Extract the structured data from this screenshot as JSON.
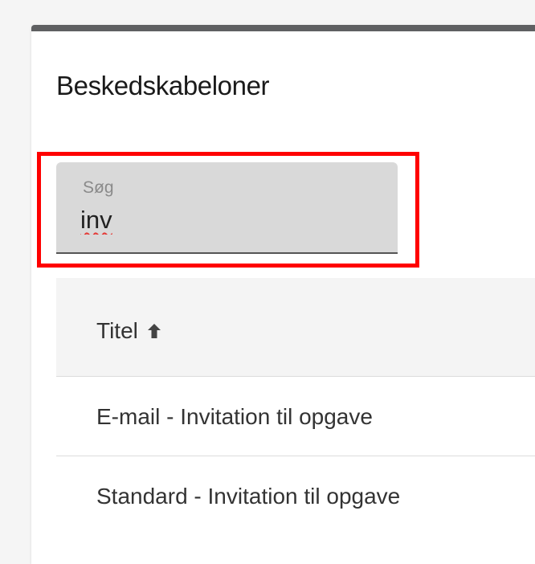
{
  "panel": {
    "title": "Beskedskabeloner"
  },
  "search": {
    "label": "Søg",
    "value": "inv"
  },
  "table": {
    "columns": [
      {
        "label": "Titel",
        "sort": "ascending",
        "sort_icon": "arrow-up-icon"
      }
    ],
    "rows": [
      {
        "title": "E-mail - Invitation til opgave"
      },
      {
        "title": "Standard - Invitation til opgave"
      }
    ]
  },
  "colors": {
    "highlight": "#ff0000",
    "header_bar": "#5f6062",
    "field_background": "#d9d9d9",
    "spellcheck": "#e53935"
  }
}
